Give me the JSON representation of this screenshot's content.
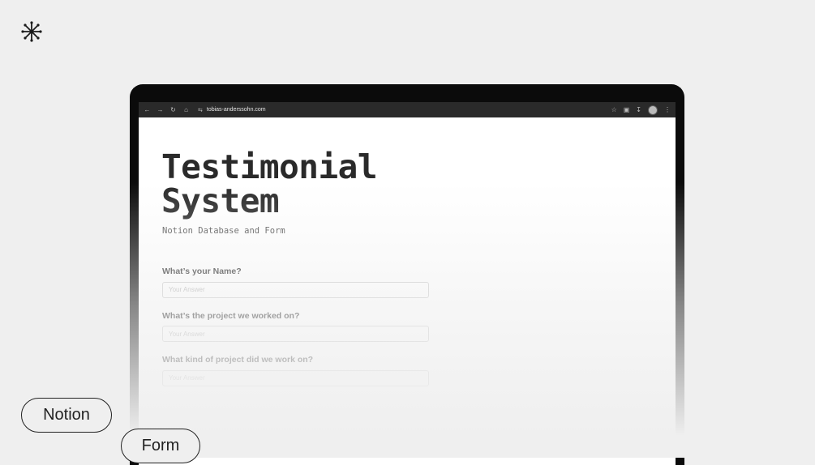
{
  "browser": {
    "url": "tobias-anderssohn.com",
    "icons": [
      "back-arrow-icon",
      "forward-arrow-icon",
      "reload-icon",
      "home-icon",
      "site-settings-icon",
      "star-icon",
      "extensions-icon",
      "download-icon",
      "profile-avatar",
      "more-menu-icon"
    ]
  },
  "page": {
    "title_line1": "Testimonial",
    "title_line2": "System",
    "subtitle": "Notion Database and Form",
    "questions": [
      {
        "label": "What’s your Name?",
        "placeholder": "Your Answer"
      },
      {
        "label": "What’s the project we worked on?",
        "placeholder": "Your Answer"
      },
      {
        "label": "What kind of project did we work on?",
        "placeholder": "Your Answer"
      }
    ]
  },
  "tags": {
    "first": "Notion",
    "second": "Form"
  }
}
